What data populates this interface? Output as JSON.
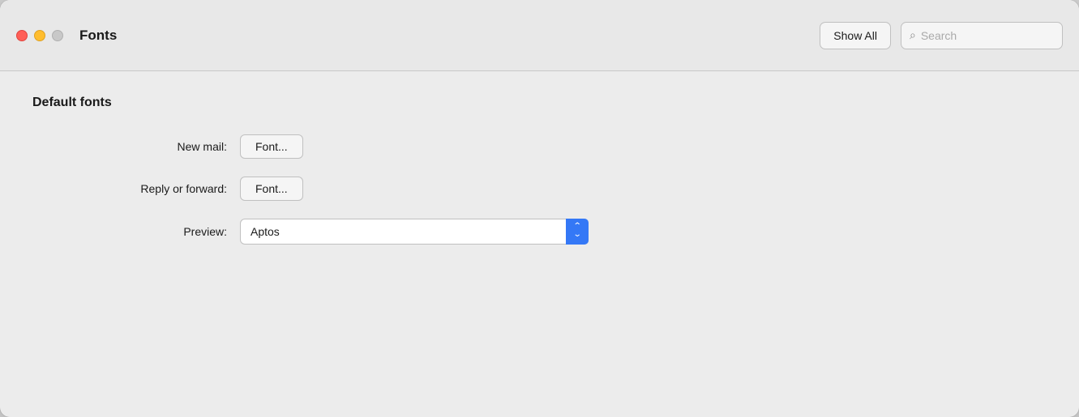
{
  "window": {
    "title": "Fonts"
  },
  "titlebar": {
    "show_all_label": "Show All",
    "search_placeholder": "Search"
  },
  "traffic_lights": {
    "close_label": "close",
    "minimize_label": "minimize",
    "zoom_label": "zoom"
  },
  "content": {
    "section_title": "Default fonts",
    "form_rows": [
      {
        "label": "New mail:",
        "button_label": "Font...",
        "type": "button"
      },
      {
        "label": "Reply or forward:",
        "button_label": "Font...",
        "type": "button"
      },
      {
        "label": "Preview:",
        "select_value": "Aptos",
        "type": "select"
      }
    ]
  },
  "icons": {
    "search": "🔍",
    "chevron_up_down": "⇕"
  },
  "colors": {
    "close": "#ff5f57",
    "minimize": "#ffbd2e",
    "zoom": "#c8c8c8",
    "accent": "#3478f6"
  }
}
